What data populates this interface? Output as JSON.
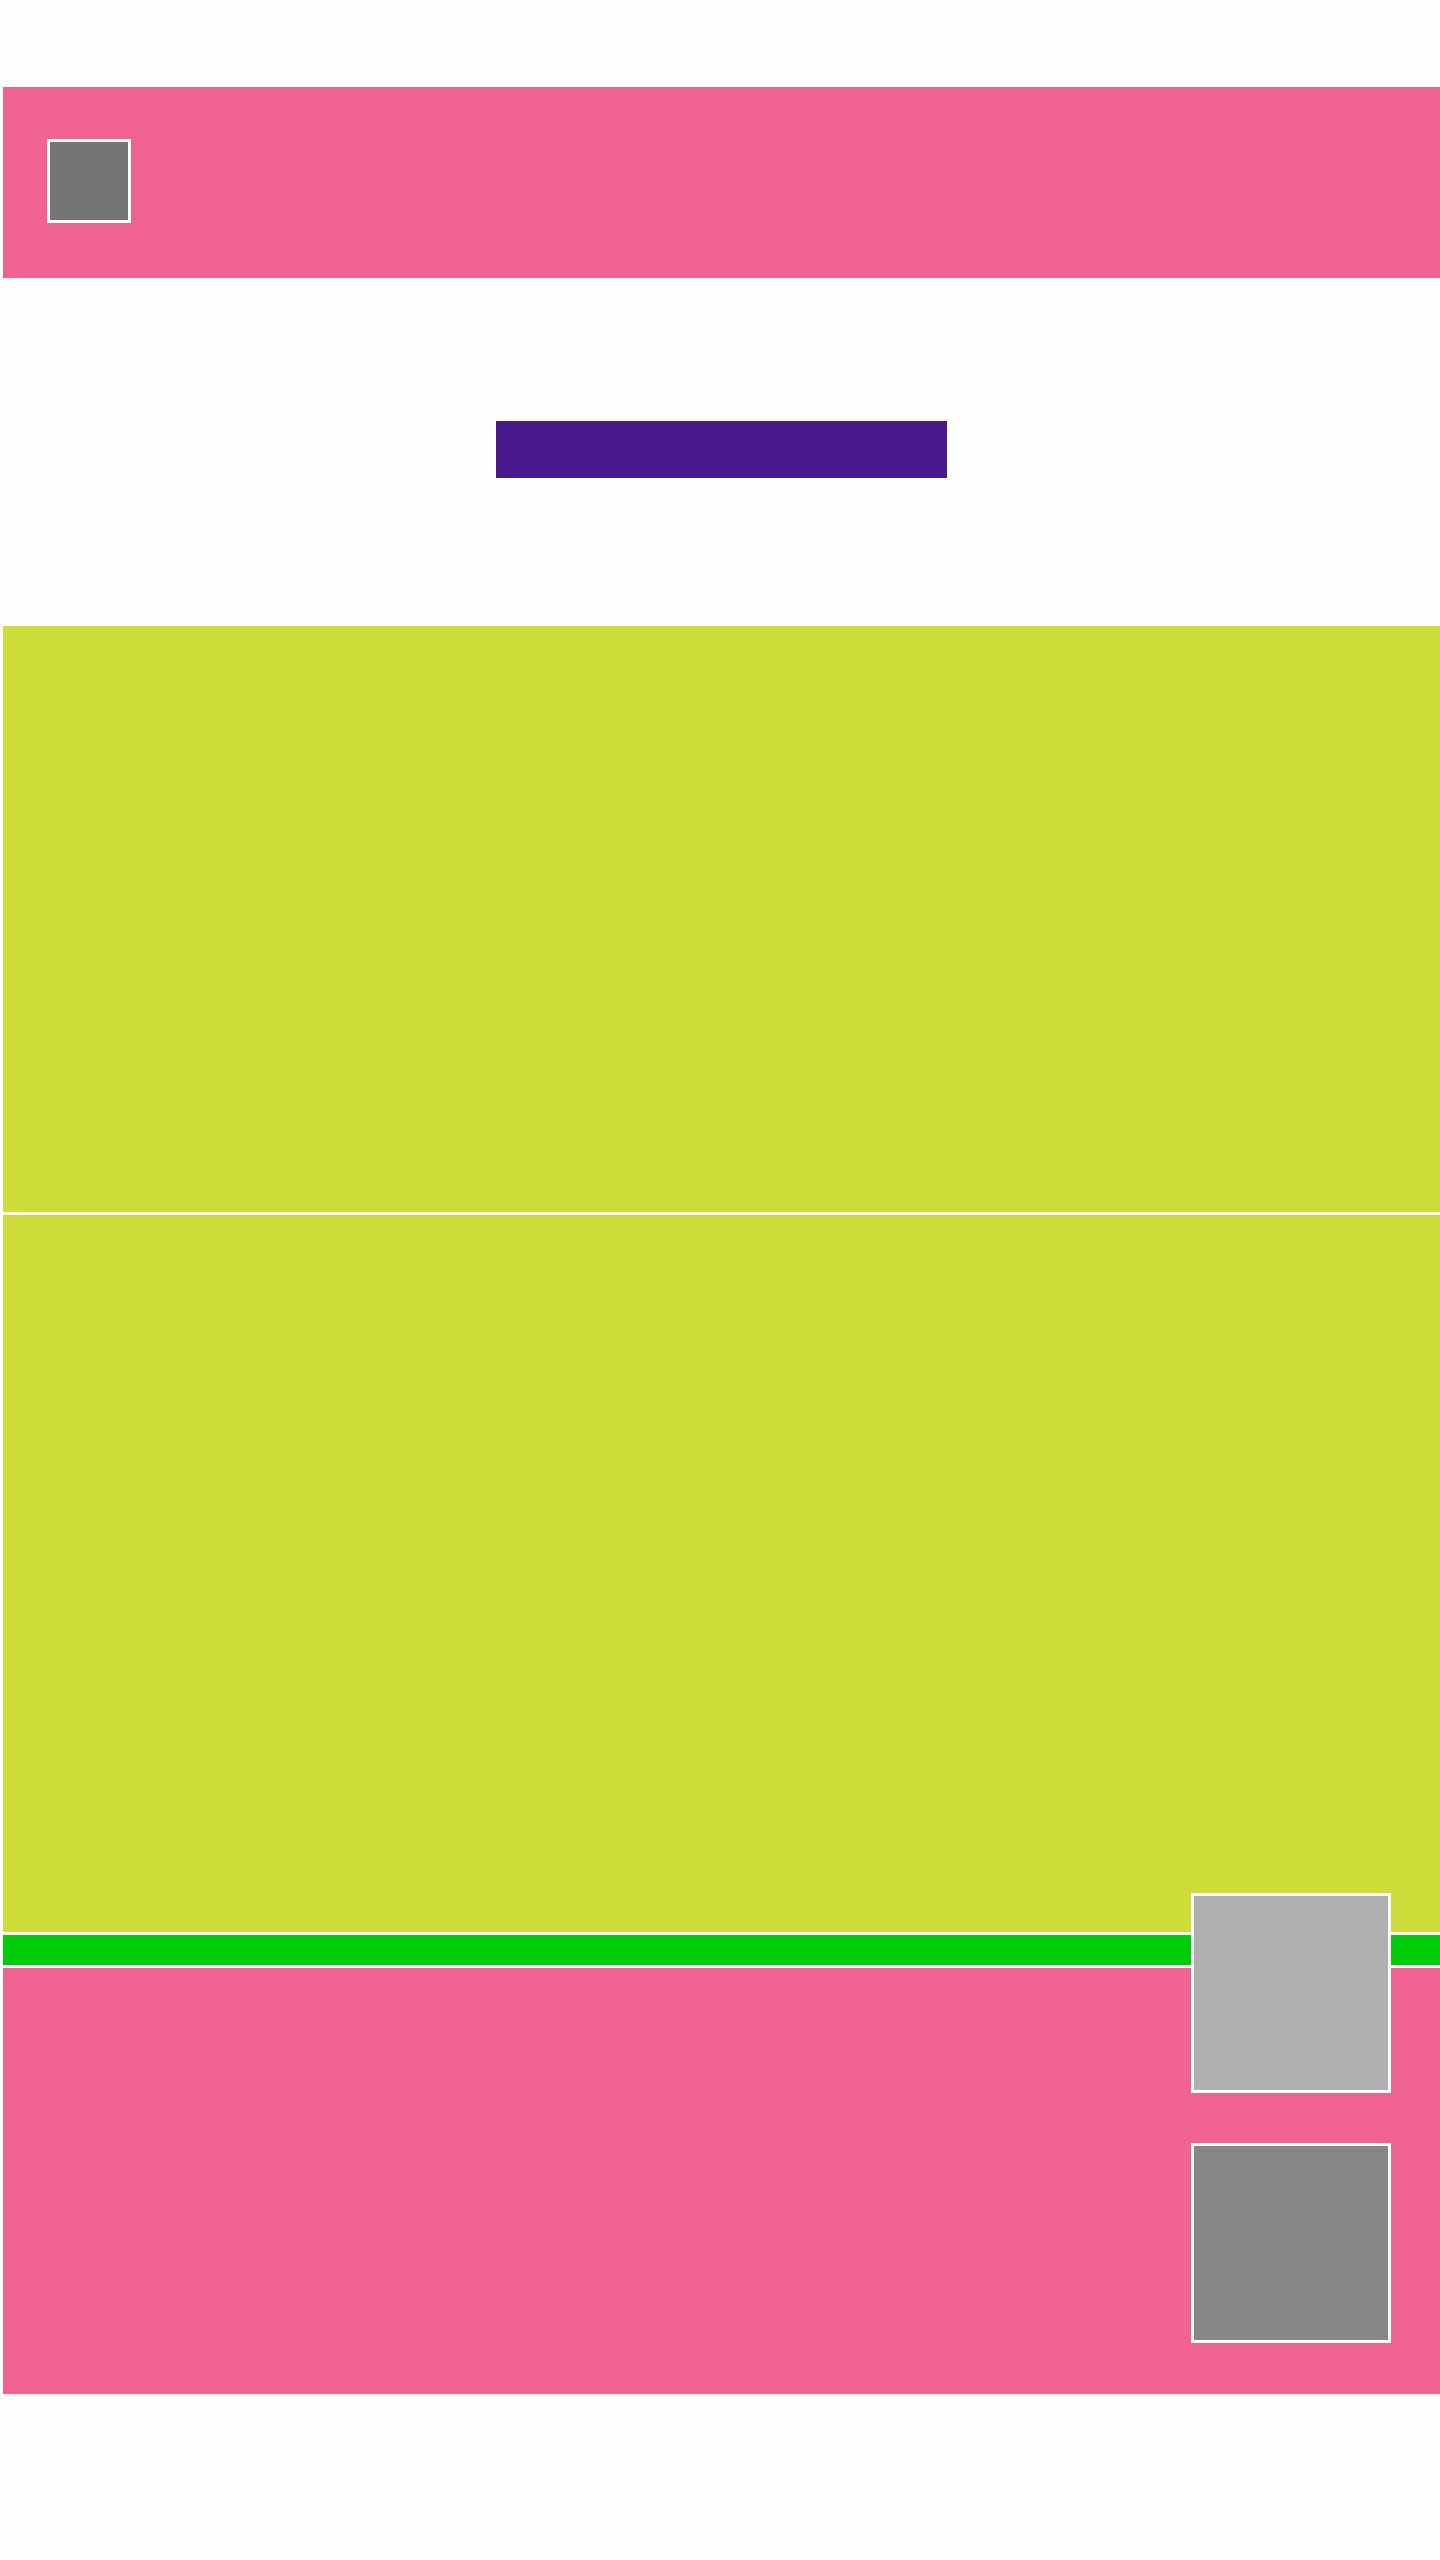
{
  "theme": {
    "primary": "#f06292",
    "accent": "#4a1a8c",
    "content": "#cddc39",
    "highlight": "#00cc0a",
    "background": "#fdfdfd"
  },
  "toolbar": {
    "icon": "image-placeholder-icon",
    "icon_color": "#757575"
  },
  "title_block": {
    "color": "#4a1a8c"
  },
  "sections": {
    "top_color": "#cddc39",
    "middle_color": "#cddc39",
    "strip_color": "#00cc0a",
    "bottom_color": "#f06292"
  },
  "fabs": [
    {
      "icon": "image-placeholder-icon",
      "color": "#b0b0b0"
    },
    {
      "icon": "image-placeholder-icon",
      "color": "#878787"
    }
  ]
}
